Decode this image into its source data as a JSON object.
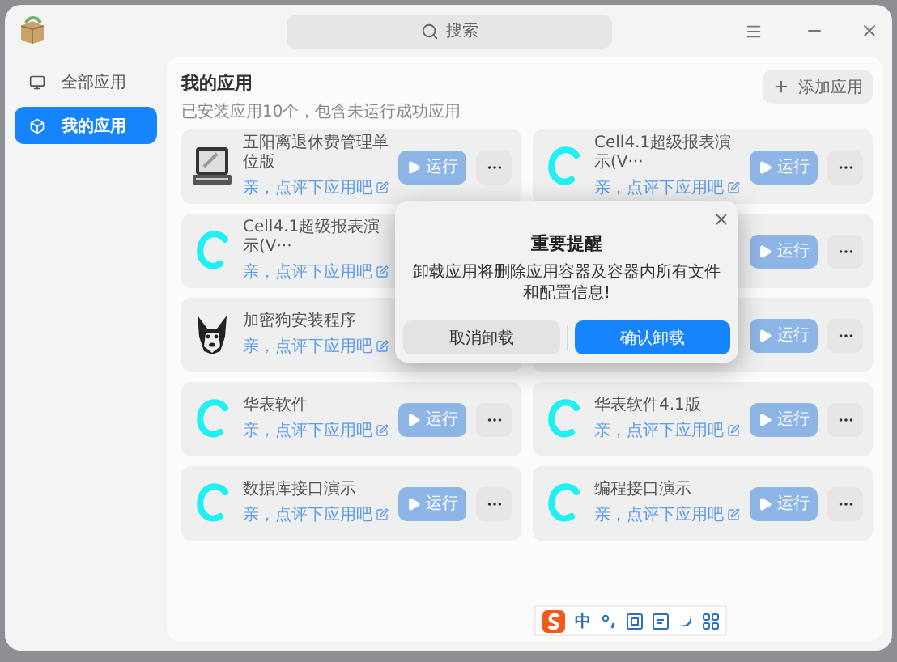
{
  "window": {
    "search": {
      "placeholder": "搜索"
    }
  },
  "sidebar": {
    "items": [
      {
        "label": "全部应用",
        "selected": false
      },
      {
        "label": "我的应用",
        "selected": true
      }
    ]
  },
  "content": {
    "title": "我的应用",
    "subtitle": "已安装应用10个，包含未运行成功应用",
    "add_button": "添加应用",
    "apps": [
      {
        "kind": "computer",
        "title": "五阳离退休费管理单位版",
        "link": "亲，点评下应用吧",
        "run": "运行",
        "more": true
      },
      {
        "kind": "c-logo",
        "title": "Cell4.1超级报表演示(V···",
        "link": "亲，点评下应用吧",
        "run": "运行",
        "more": true
      },
      {
        "kind": "c-logo",
        "title": "Cell4.1超级报表演示(V···",
        "link": "亲，点评下应用吧"
      },
      {
        "kind": "covered",
        "run": "运行",
        "more": true
      },
      {
        "kind": "dog",
        "title": "加密狗安装程序",
        "link": "亲，点评下应用吧"
      },
      {
        "kind": "covered",
        "run": "运行",
        "more": true
      },
      {
        "kind": "c-logo",
        "title": "华表软件",
        "link": "亲，点评下应用吧",
        "run": "运行",
        "more": true
      },
      {
        "kind": "c-logo",
        "title": "华表软件4.1版",
        "link": "亲，点评下应用吧",
        "run": "运行",
        "more": true
      },
      {
        "kind": "c-logo",
        "title": "数据库接口演示",
        "link": "亲，点评下应用吧",
        "run": "运行",
        "more": true
      },
      {
        "kind": "c-logo",
        "title": "编程接口演示",
        "link": "亲，点评下应用吧",
        "run": "运行",
        "more": true
      }
    ]
  },
  "dialog": {
    "title": "重要提醒",
    "message": "卸载应用将删除应用容器及容器内所有文件和配置信息!",
    "buttons": [
      {
        "label": "取消卸载",
        "kind": "secondary"
      },
      {
        "label": "确认卸载",
        "kind": "primary"
      }
    ]
  },
  "ime_toolbar": {
    "mode": "中"
  }
}
